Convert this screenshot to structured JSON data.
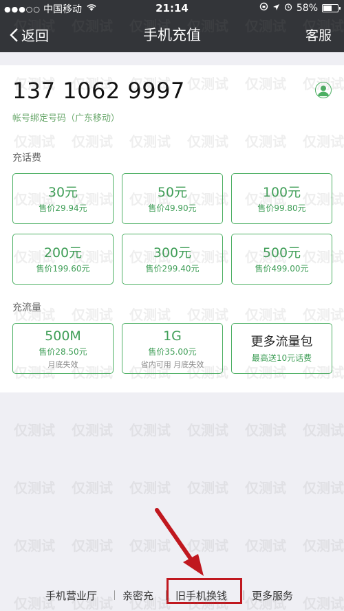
{
  "status_bar": {
    "signal": "●●●○○",
    "carrier": "中国移动",
    "time": "21:14",
    "battery": "58%",
    "battery_level": 0.58
  },
  "nav": {
    "back_label": "返回",
    "title": "手机充值",
    "service_label": "客服"
  },
  "account": {
    "phone_number": "137 1062 9997",
    "binding_text": "帐号绑定号码（广东移动）"
  },
  "recharge": {
    "section_label": "充话费",
    "options": [
      {
        "amount": "30元",
        "price": "售价29.94元"
      },
      {
        "amount": "50元",
        "price": "售价49.90元"
      },
      {
        "amount": "100元",
        "price": "售价99.80元"
      },
      {
        "amount": "200元",
        "price": "售价199.60元"
      },
      {
        "amount": "300元",
        "price": "售价299.40元"
      },
      {
        "amount": "500元",
        "price": "售价499.00元"
      }
    ]
  },
  "data_plan": {
    "section_label": "充流量",
    "options": [
      {
        "amount": "500M",
        "price": "售价28.50元",
        "note": "月底失效"
      },
      {
        "amount": "1G",
        "price": "售价35.00元",
        "note": "省内可用 月底失效"
      },
      {
        "amount": "更多流量包",
        "price": "最高送10元话费"
      }
    ]
  },
  "bottom_links": [
    "手机营业厅",
    "亲密充",
    "旧手机换钱",
    "更多服务"
  ],
  "watermark": "仅测试",
  "colors": {
    "accent": "#4caf63",
    "header": "#333539",
    "highlight": "#c0181f"
  }
}
